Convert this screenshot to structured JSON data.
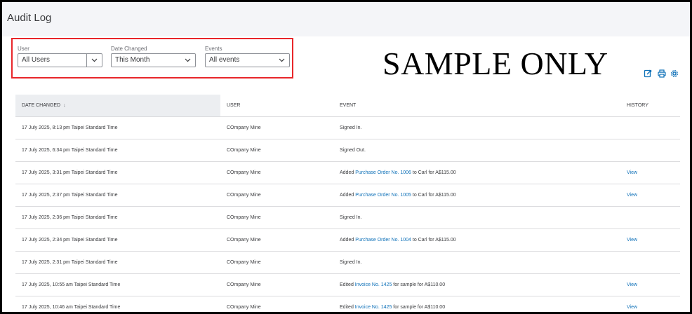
{
  "page": {
    "title": "Audit Log",
    "watermark": "SAMPLE ONLY"
  },
  "filters": {
    "user": {
      "label": "User",
      "value": "All Users"
    },
    "date_changed": {
      "label": "Date Changed",
      "value": "This Month"
    },
    "events": {
      "label": "Events",
      "value": "All events"
    }
  },
  "toolbar_icons": [
    "export-icon",
    "print-icon",
    "settings-icon"
  ],
  "table": {
    "columns": {
      "date_changed": "DATE CHANGED",
      "sort_indicator": "↓",
      "user": "USER",
      "event": "EVENT",
      "history": "HISTORY"
    },
    "rows": [
      {
        "date": "17 July 2025, 8:13 pm Taipei Standard Time",
        "user": "COmpany Mine",
        "event_prefix": "Signed In.",
        "event_link": "",
        "event_suffix": "",
        "history": ""
      },
      {
        "date": "17 July 2025, 6:34 pm Taipei Standard Time",
        "user": "COmpany Mine",
        "event_prefix": "Signed Out.",
        "event_link": "",
        "event_suffix": "",
        "history": ""
      },
      {
        "date": "17 July 2025, 3:31 pm Taipei Standard Time",
        "user": "COmpany Mine",
        "event_prefix": "Added ",
        "event_link": "Purchase Order No. 1006",
        "event_suffix": " to Carl for A$115.00",
        "history": "View"
      },
      {
        "date": "17 July 2025, 2:37 pm Taipei Standard Time",
        "user": "COmpany Mine",
        "event_prefix": "Added ",
        "event_link": "Purchase Order No. 1005",
        "event_suffix": " to Carl for A$115.00",
        "history": "View"
      },
      {
        "date": "17 July 2025, 2:36 pm Taipei Standard Time",
        "user": "COmpany Mine",
        "event_prefix": "Signed In.",
        "event_link": "",
        "event_suffix": "",
        "history": ""
      },
      {
        "date": "17 July 2025, 2:34 pm Taipei Standard Time",
        "user": "COmpany Mine",
        "event_prefix": "Added ",
        "event_link": "Purchase Order No. 1004",
        "event_suffix": " to Carl for A$115.00",
        "history": "View"
      },
      {
        "date": "17 July 2025, 2:31 pm Taipei Standard Time",
        "user": "COmpany Mine",
        "event_prefix": "Signed In.",
        "event_link": "",
        "event_suffix": "",
        "history": ""
      },
      {
        "date": "17 July 2025, 10:55 am Taipei Standard Time",
        "user": "COmpany Mine",
        "event_prefix": "Edited ",
        "event_link": "Invoice No. 1425",
        "event_suffix": " for sample for A$110.00",
        "history": "View"
      },
      {
        "date": "17 July 2025, 10:46 am Taipei Standard Time",
        "user": "COmpany Mine",
        "event_prefix": "Edited ",
        "event_link": "Invoice No. 1425",
        "event_suffix": " for sample for A$110.00",
        "history": "View"
      }
    ]
  },
  "colors": {
    "link": "#0d70b8",
    "highlight_border": "#e8262a",
    "header_bg": "#f4f5f8"
  }
}
